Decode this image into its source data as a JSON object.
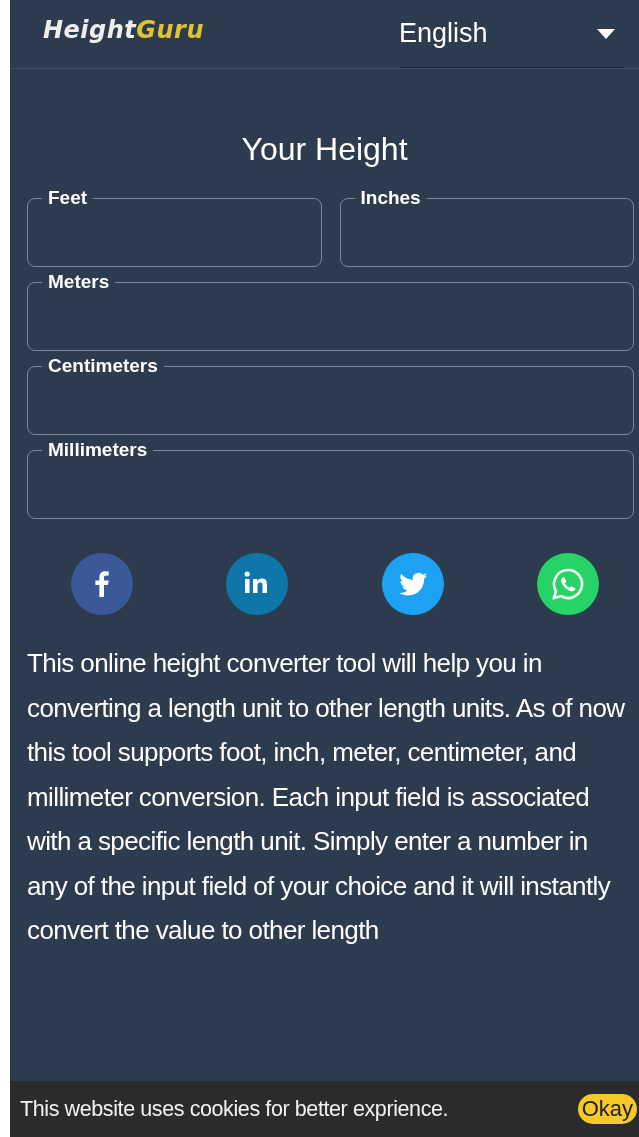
{
  "header": {
    "logo": {
      "first": "Height",
      "second": "Guru"
    },
    "language": {
      "value": "English"
    }
  },
  "title": "Your Height",
  "fields": [
    {
      "label": "Feet"
    },
    {
      "label": "Inches"
    },
    {
      "label": "Meters"
    },
    {
      "label": "Centimeters"
    },
    {
      "label": "Millimeters"
    }
  ],
  "share": [
    {
      "kind": "facebook"
    },
    {
      "kind": "linkedin"
    },
    {
      "kind": "twitter"
    },
    {
      "kind": "whatsapp"
    }
  ],
  "description": "This online height converter tool will help you in converting a length unit to other length units. As of now this tool supports foot, inch, meter, centimeter, and millimeter conversion. Each input field is associated with a specific length unit. Simply enter a number in any of the input field of your choice and it will instantly convert the value to other length",
  "cookie_bar": {
    "text": "This website uses cookies for better exprience.",
    "button": "Okay"
  }
}
